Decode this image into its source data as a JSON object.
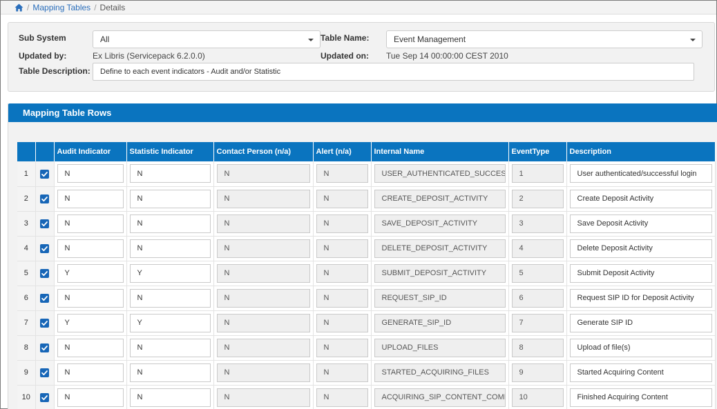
{
  "breadcrumb": {
    "home_icon": "home-icon",
    "items": [
      "Mapping Tables",
      "Details"
    ]
  },
  "header": {
    "sub_system_label": "Sub System",
    "sub_system_value": "All",
    "table_name_label": "Table Name:",
    "table_name_value": "Event Management",
    "updated_by_label": "Updated by:",
    "updated_by_value": "Ex Libris (Servicepack 6.2.0.0)",
    "updated_on_label": "Updated on:",
    "updated_on_value": "Tue Sep 14 00:00:00 CEST 2010",
    "description_label": "Table Description:",
    "description_value": "Define to each event indicators -  Audit and/or Statistic"
  },
  "rows_panel": {
    "title": "Mapping Table Rows",
    "columns": [
      "Audit Indicator",
      "Statistic Indicator",
      "Contact Person (n/a)",
      "Alert (n/a)",
      "Internal Name",
      "EventType",
      "Description"
    ],
    "rows": [
      {
        "num": "1",
        "checked": true,
        "audit": "N",
        "statistic": "N",
        "contact": "N",
        "alert": "N",
        "internal": "USER_AUTHENTICATED_SUCCESSFULLY",
        "event_type": "1",
        "description": "User authenticated/successful login"
      },
      {
        "num": "2",
        "checked": true,
        "audit": "N",
        "statistic": "N",
        "contact": "N",
        "alert": "N",
        "internal": "CREATE_DEPOSIT_ACTIVITY",
        "event_type": "2",
        "description": "Create Deposit Activity"
      },
      {
        "num": "3",
        "checked": true,
        "audit": "N",
        "statistic": "N",
        "contact": "N",
        "alert": "N",
        "internal": "SAVE_DEPOSIT_ACTIVITY",
        "event_type": "3",
        "description": "Save Deposit Activity"
      },
      {
        "num": "4",
        "checked": true,
        "audit": "N",
        "statistic": "N",
        "contact": "N",
        "alert": "N",
        "internal": "DELETE_DEPOSIT_ACTIVITY",
        "event_type": "4",
        "description": "Delete Deposit Activity"
      },
      {
        "num": "5",
        "checked": true,
        "audit": "Y",
        "statistic": "Y",
        "contact": "N",
        "alert": "N",
        "internal": "SUBMIT_DEPOSIT_ACTIVITY",
        "event_type": "5",
        "description": "Submit Deposit Activity"
      },
      {
        "num": "6",
        "checked": true,
        "audit": "N",
        "statistic": "N",
        "contact": "N",
        "alert": "N",
        "internal": "REQUEST_SIP_ID",
        "event_type": "6",
        "description": "Request SIP ID for Deposit Activity"
      },
      {
        "num": "7",
        "checked": true,
        "audit": "Y",
        "statistic": "Y",
        "contact": "N",
        "alert": "N",
        "internal": "GENERATE_SIP_ID",
        "event_type": "7",
        "description": "Generate SIP ID"
      },
      {
        "num": "8",
        "checked": true,
        "audit": "N",
        "statistic": "N",
        "contact": "N",
        "alert": "N",
        "internal": "UPLOAD_FILES",
        "event_type": "8",
        "description": "Upload of file(s)"
      },
      {
        "num": "9",
        "checked": true,
        "audit": "N",
        "statistic": "N",
        "contact": "N",
        "alert": "N",
        "internal": "STARTED_ACQUIRING_FILES",
        "event_type": "9",
        "description": "Started Acquiring Content"
      },
      {
        "num": "10",
        "checked": true,
        "audit": "N",
        "statistic": "N",
        "contact": "N",
        "alert": "N",
        "internal": "ACQUIRING_SIP_CONTENT_COMPLETED",
        "event_type": "10",
        "description": "Finished Acquiring Content"
      }
    ]
  },
  "colors": {
    "accent": "#0a74bf",
    "link": "#2a6ebb",
    "checkbox": "#1766b7"
  }
}
